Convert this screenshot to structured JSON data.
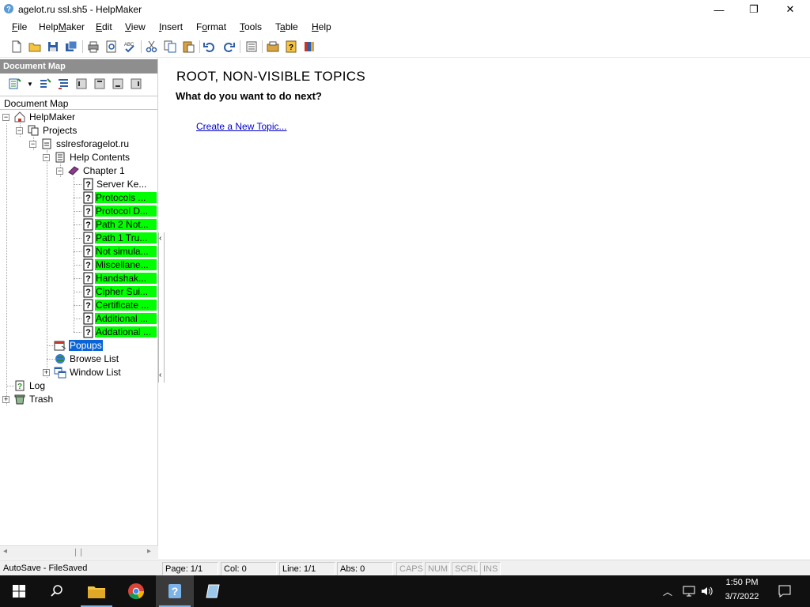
{
  "window": {
    "title": "agelot.ru ssl.sh5 - HelpMaker",
    "minimize_glyph": "—",
    "restore_glyph": "❐",
    "close_glyph": "✕"
  },
  "menu": {
    "file": {
      "ul": "F",
      "rest": "ile"
    },
    "helpmaker": {
      "pre": "Help",
      "ul": "M",
      "rest": "aker"
    },
    "edit": {
      "ul": "E",
      "rest": "dit"
    },
    "view": {
      "ul": "V",
      "rest": "iew"
    },
    "insert": {
      "ul": "I",
      "rest": "nsert"
    },
    "format": {
      "pre": "F",
      "ul": "o",
      "rest": "rmat"
    },
    "tools": {
      "ul": "T",
      "rest": "ools"
    },
    "table": {
      "pre": "T",
      "ul": "a",
      "rest": "ble"
    },
    "help": {
      "ul": "H",
      "rest": "elp"
    }
  },
  "document_map": {
    "header": "Document Map",
    "tab": "Document Map",
    "tree": {
      "root": "HelpMaker",
      "projects": "Projects",
      "project": "sslresforagelot.ru",
      "help_contents": "Help Contents",
      "chapter": "Chapter 1",
      "topics": [
        "Server Ke...",
        "Protocols ...",
        "Protocol D...",
        "Path 2 Not...",
        "Path 1 Tru...",
        "Not simula...",
        "Miscellane...",
        "Handshak...",
        "Cipher Sui...",
        "Certificate ...",
        "Additional ...",
        "Addational ..."
      ],
      "popups": "Popups",
      "browse_list": "Browse List",
      "window_list": "Window List",
      "log": "Log",
      "trash": "Trash"
    }
  },
  "editor": {
    "heading": "ROOT, NON-VISIBLE TOPICS",
    "subheading": "What do you want to do next?",
    "link": "Create a New Topic..."
  },
  "status": {
    "autosave": "AutoSave - FileSaved",
    "page": "Page: 1/1",
    "col": "Col: 0",
    "line": "Line: 1/1",
    "abs": "Abs: 0",
    "caps": "CAPS",
    "num": "NUM",
    "scrl": "SCRL",
    "ins": "INS"
  },
  "taskbar": {
    "time": "1:50 PM",
    "date": "3/7/2022"
  },
  "colors": {
    "highlight_green": "#00ff00",
    "selection_blue": "#0a64d7",
    "taskbar": "#101010"
  }
}
